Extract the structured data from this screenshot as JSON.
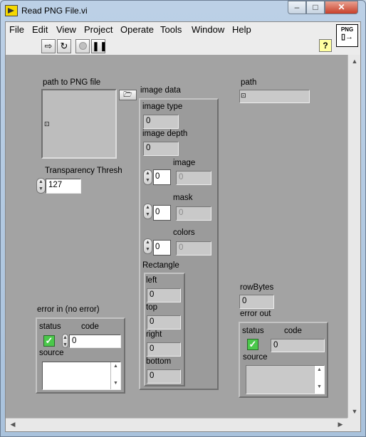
{
  "window": {
    "title": "Read PNG File.vi",
    "min": "–",
    "max": "□",
    "close": "✕"
  },
  "menu": [
    "File",
    "Edit",
    "View",
    "Project",
    "Operate",
    "Tools",
    "Window",
    "Help"
  ],
  "toolbar": {
    "run_icon": "run-arrow-icon",
    "run_cont_icon": "run-continuously-icon",
    "abort_icon": "abort-icon",
    "pause_icon": "pause-icon",
    "help": "?"
  },
  "vi_icon": {
    "text": "PNG"
  },
  "path_to_png": {
    "label": "path to PNG file",
    "value": ""
  },
  "transparency": {
    "label": "Transparency Thresh",
    "value": "127"
  },
  "image_data": {
    "label": "image data",
    "image_type": {
      "label": "image type",
      "value": "0"
    },
    "image_depth": {
      "label": "image depth",
      "value": "0"
    },
    "image": {
      "label": "image",
      "index": "0",
      "value": "0"
    },
    "mask": {
      "label": "mask",
      "index": "0",
      "value": "0"
    },
    "colors": {
      "label": "colors",
      "index": "0",
      "value": "0"
    },
    "rectangle": {
      "label": "Rectangle",
      "left": {
        "label": "left",
        "value": "0"
      },
      "top": {
        "label": "top",
        "value": "0"
      },
      "right": {
        "label": "right",
        "value": "0"
      },
      "bottom": {
        "label": "bottom",
        "value": "0"
      }
    }
  },
  "path_out": {
    "label": "path",
    "value": ""
  },
  "rowbytes": {
    "label": "rowBytes",
    "value": "0"
  },
  "error_in": {
    "label": "error in (no error)",
    "status": "status",
    "code": "code",
    "code_value": "0",
    "source": "source",
    "source_value": ""
  },
  "error_out": {
    "label": "error out",
    "status": "status",
    "code": "code",
    "code_value": "0",
    "source": "source",
    "source_value": ""
  }
}
